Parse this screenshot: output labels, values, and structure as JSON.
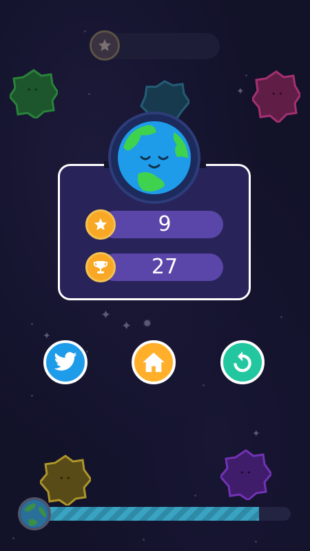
{
  "top_progress": {
    "icon": "star-icon"
  },
  "panel": {
    "stars_count": "9",
    "best_score": "27"
  },
  "buttons": {
    "twitter_icon": "twitter-bird-icon",
    "home_icon": "home-icon",
    "replay_icon": "replay-icon"
  },
  "bottom_progress": {
    "fraction": 0.88
  },
  "colors": {
    "twitter": "#1e9be9",
    "home": "#ffaf2a",
    "replay": "#22c7a0",
    "stat_icon": "#f9a825",
    "stat_pill": "#5946a8"
  }
}
